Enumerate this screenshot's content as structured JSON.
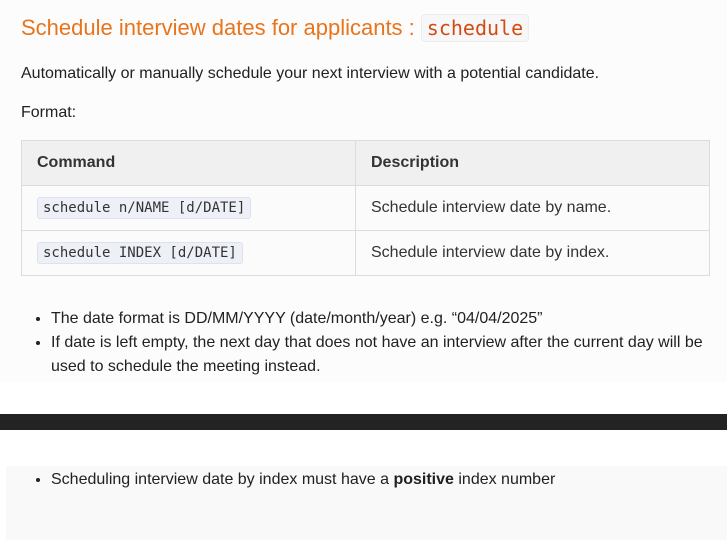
{
  "header": {
    "title_text": "Schedule interview dates for applicants :",
    "title_code": "schedule"
  },
  "intro": "Automatically or manually schedule your next interview with a potential candidate.",
  "format_label": "Format:",
  "table": {
    "headers": [
      "Command",
      "Description"
    ],
    "rows": [
      {
        "command": "schedule n/NAME [d/DATE]",
        "description": "Schedule interview date by name."
      },
      {
        "command": "schedule INDEX [d/DATE]",
        "description": "Schedule interview date by index."
      }
    ]
  },
  "notes": [
    "The date format is DD/MM/YYYY (date/month/year) e.g. “04/04/2025”",
    "If date is left empty, the next day that does not have an interview after the current day will be used to schedule the meeting instead."
  ],
  "bottom_note": {
    "before": "Scheduling interview date by index must have a",
    "bold": "positive",
    "after": "index number"
  }
}
